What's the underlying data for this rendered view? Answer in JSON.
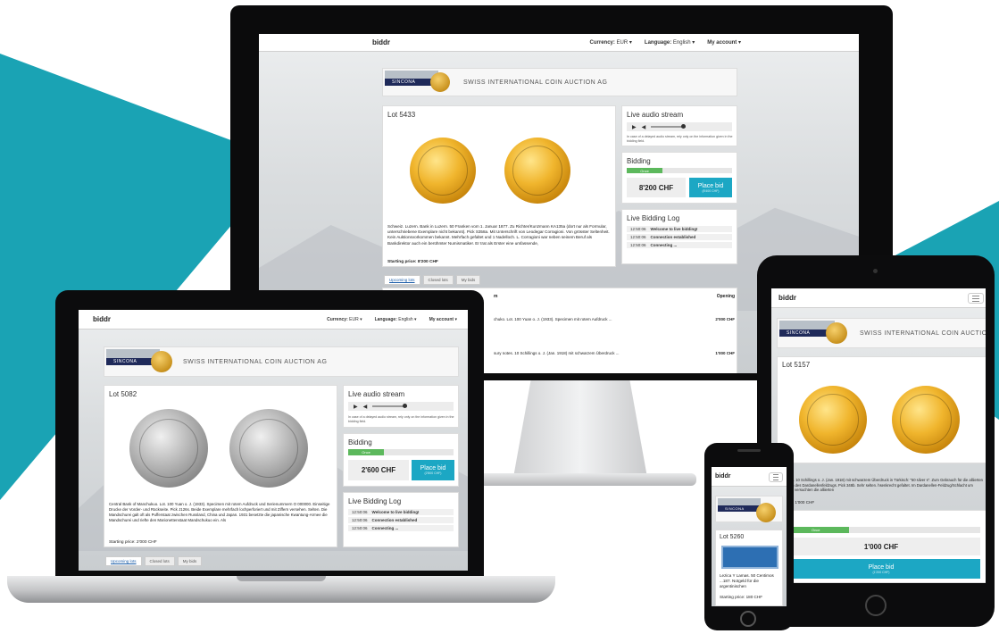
{
  "brand": "biddr",
  "nav": {
    "currency": "Currency:",
    "currency_value": "EUR",
    "language": "Language:",
    "language_value": "English",
    "account": "My account"
  },
  "auction_house": {
    "badge": "SINCONA",
    "title": "SWISS INTERNATIONAL COIN AUCTION AG"
  },
  "panels": {
    "audio_title": "Live audio stream",
    "audio_note": "In case of a delayed audio stream, rely only on the information given in the bidding field.",
    "bidding_title": "Bidding",
    "progress_label": "Once",
    "place_bid": "Place bid",
    "log_title": "Live Bidding Log",
    "log": [
      {
        "time": "12:50:06",
        "msg": "Welcome to live bidding!"
      },
      {
        "time": "12:50:06",
        "msg": "Connection established"
      },
      {
        "time": "12:50:06",
        "msg": "Connecting ..."
      }
    ]
  },
  "tabs": [
    "Upcoming lots",
    "Closed lots",
    "My bids"
  ],
  "monitor": {
    "lot": "Lot 5433",
    "description": "Schweiz. Luzern. Bank in Luzern. 50 Franken vom 1. Januar 1877. Zu Richter/Kunzmann KA135a (dort nur als Formular, unterschriebene Exemplare nicht bekannt). Pick S358a. Mit Unterschrift von Leodegar Corragioni. Von grösster Seltenheit. Kein Auktionsvorkommen bekannt. Mehrfach gefaltet und 1 Nadelloch. L. Corragioni war neben seinem Beruf als Bankdirektor auch ein berühmter Numismatiker. Er trat als Erster eine umfassende,",
    "starting_price": "Starting price: 8'200 CHF",
    "price": "8'200 CHF",
    "bid_sub": "(8'400 CHF)",
    "table_header": "m",
    "table_header_opening": "Opening",
    "rows": [
      {
        "text": "chuko. Lot. 100 Yuan o. J. (1933). Specimen mit rotem Aufdruck ...",
        "opening": "2'000 CHF"
      },
      {
        "text": "sury notes. 10 Schillings o. J. (Jan. 1918) mit schwarzem Überdruck ...",
        "opening": "1'000 CHF"
      }
    ]
  },
  "laptop": {
    "lot": "Lot 5082",
    "description": "Central Bank of Manchukuo. Lot. 100 Yuan o. J. (1933). Specimen mit rotem Aufdruck und Serienummern O 000000. Einseitige Drucke der Vorder- und Rückseite. Pick J126s. Beide Exemplare mehrfach lochperforiert und mit Ziffern versehen. Selten. Die Mandschurei galt oft als Pufferstaat zwischen Russland, China und Japan. 1931 besetzte die japanische Kwantung-Armee die Mandschurei und riefte den Marionettenstaat Mandschukuo ein. Als",
    "starting_price": "Starting price: 2'000 CHF",
    "price": "2'600 CHF",
    "bid_sub": "(2'800 CHF)"
  },
  "tablet": {
    "lot": "Lot 5157",
    "description": "ry notes. 10 Schillings o. J. (Jan. 1918) mit schwarzem Überdruck in Türkisch: \"50 silver s\". Zum Gebrauch für die alliierten Truppen des Dardanellenfeldzugs. Pick 348b. Sehr selten. hsenkrecht gefaltet. Im Dardanellen-Feldzug/Schlacht um Gallipoli versuchten die alliierten",
    "starting_price": "g price: 1'000 CHF",
    "bidding_partial": "ing",
    "price": "1'000 CHF",
    "bid_sub": "(1'200 CHF)"
  },
  "phone": {
    "lot": "Lot 5260",
    "description": "Lezica Y Lamas. 50 Centimos ...187. Notgeld für die argentinischen",
    "starting_price": "Starting price: 180 CHF"
  },
  "colors": {
    "accent": "#1aa3b4",
    "bid_button": "#1ca7c4",
    "progress": "#5cb85c",
    "sincona": "#1f2a5a"
  }
}
